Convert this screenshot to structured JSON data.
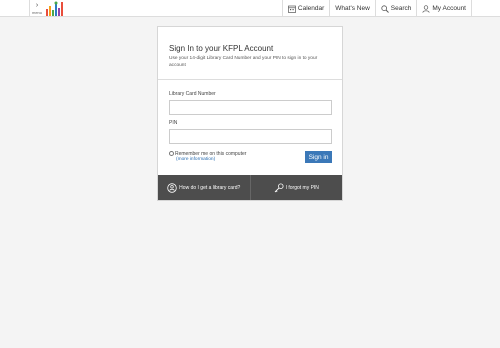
{
  "header": {
    "menu_label": "menu",
    "nav": [
      {
        "label": "Calendar",
        "icon": "calendar-icon"
      },
      {
        "label": "What's New",
        "icon": ""
      },
      {
        "label": "Search",
        "icon": "search-icon"
      },
      {
        "label": "My Account",
        "icon": "user-icon"
      }
    ]
  },
  "signin": {
    "title": "Sign In to your KFPL Account",
    "subtitle": "Use your 14-digit Library Card Number and your PIN to sign in to your account",
    "card_label": "Library Card Number",
    "card_value": "",
    "pin_label": "PIN",
    "pin_value": "",
    "remember_label": "Remember me on this computer",
    "more_info": "(more information)",
    "button_label": "Sign in"
  },
  "footer": {
    "get_card": "How do I get a library card?",
    "forgot_pin": "I forgot my PIN"
  },
  "colors": {
    "accent": "#3b78b8",
    "footer_bg": "#4d4d4d",
    "page_bg": "#f4f4f4"
  }
}
